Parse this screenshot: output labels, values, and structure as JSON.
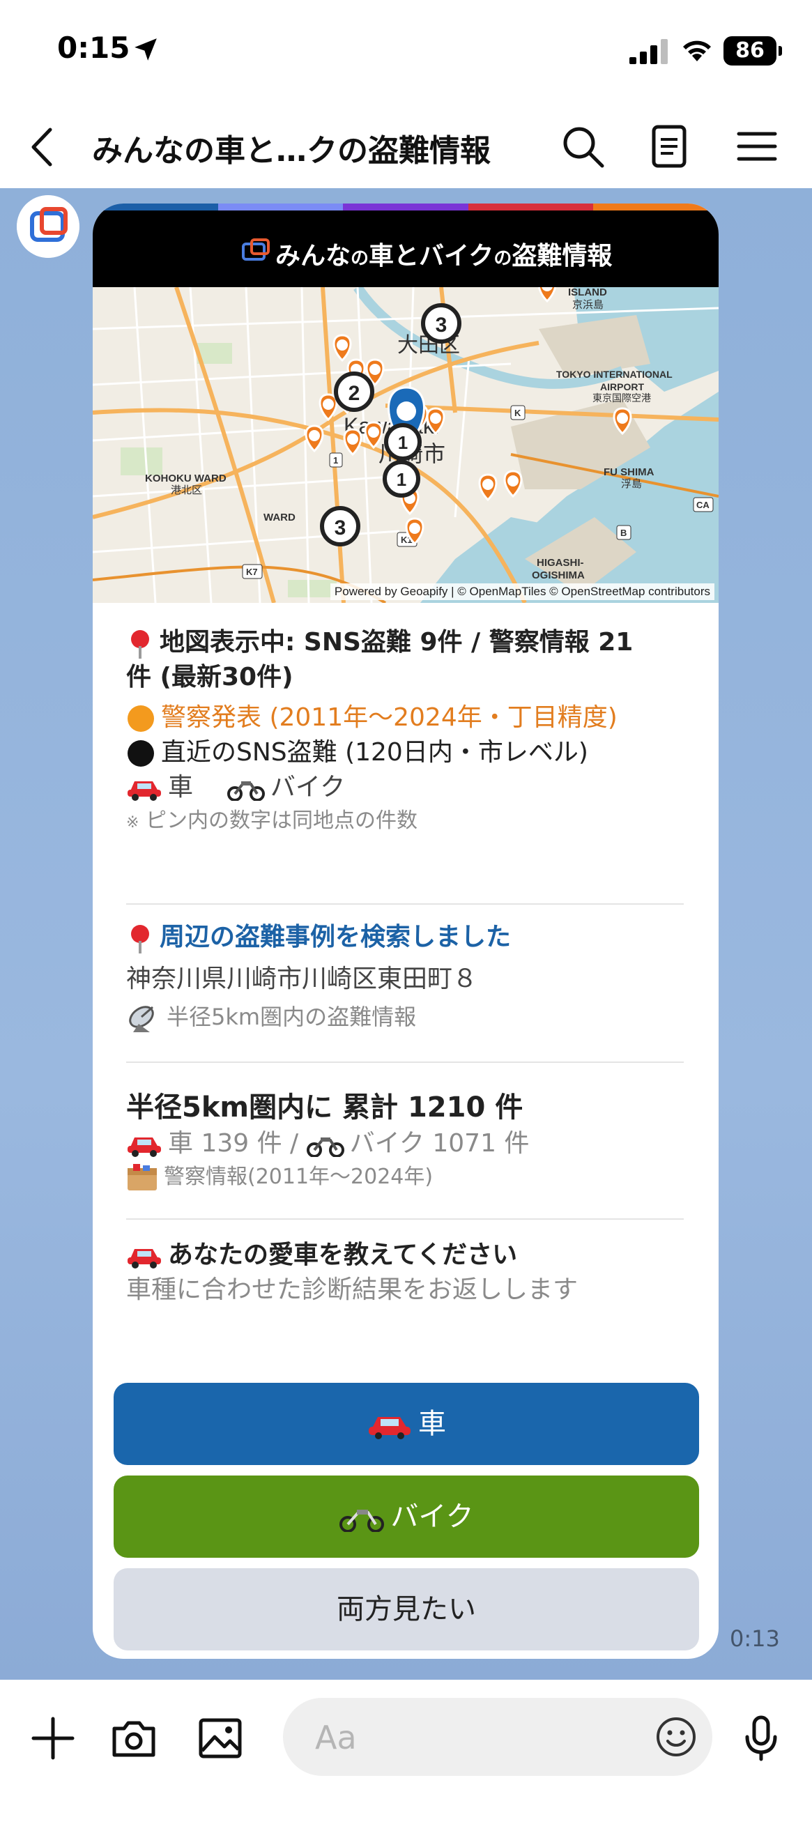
{
  "status": {
    "time": "0:15",
    "battery": "86"
  },
  "header": {
    "title": "みんなの車と…クの盗難情報"
  },
  "card": {
    "brand_prefix": "みんな",
    "brand_no1": "の",
    "brand_mid": "車とバイク",
    "brand_no2": "の",
    "brand_suffix": "盗難情報",
    "topbar_colors": [
      "#1c5fa8",
      "#7b8cf5",
      "#7a35d6",
      "#d8303c",
      "#f07a1a"
    ]
  },
  "map": {
    "labels": [
      "大田区",
      "川崎市",
      "ISLAND",
      "京浜島",
      "TOKYO INTERNATIONAL",
      "AIRPORT",
      "東京国際空港",
      "KOHOKU WARD",
      "港北区",
      "FU SHIMA",
      "浮島",
      "HIGASHI-",
      "OGISHIMA",
      "WARD",
      "Kawasaki"
    ],
    "clusters": [
      "3",
      "2",
      "1",
      "1",
      "3"
    ],
    "credit": "Powered by Geoapify | © OpenMapTiles © OpenStreetMap contributors",
    "road_badges": [
      "K1",
      "K7",
      "CA",
      "B",
      "1",
      "K"
    ]
  },
  "summary": {
    "line1": "地図表示中: SNS盗難 9件 / 警察情報 21",
    "line2": "件 (最新30件)",
    "police": "警察発表 (2011年〜2024年・丁目精度)",
    "sns": "直近のSNS盗難 (120日内・市レベル)",
    "legend_car": "車",
    "legend_bike": "バイク",
    "note": "ピン内の数字は同地点の件数"
  },
  "search": {
    "title": "周辺の盗難事例を検索しました",
    "address": "神奈川県川崎市川崎区東田町８",
    "radius": "半径5km圏内の盗難情報"
  },
  "stats": {
    "total": "半径5km圏内に 累計 1210 件",
    "breakdown_car": "車 139 件 /",
    "breakdown_bike": "バイク 1071 件",
    "source": "警察情報(2011年〜2024年)"
  },
  "ask": {
    "title": "あなたの愛車を教えてください",
    "subtitle": "車種に合わせた診断結果をお返しします"
  },
  "buttons": {
    "car": "車",
    "bike": "バイク",
    "both": "両方見たい"
  },
  "message_time": "0:13",
  "input": {
    "placeholder": "Aa"
  },
  "colors": {
    "car_button": "#1a66ac",
    "bike_button": "#5a9515",
    "both_button": "#d9dde6",
    "chat_bg": "#8fb0d9",
    "police_orange": "#e27d1f",
    "link_blue": "#1c62a6"
  }
}
